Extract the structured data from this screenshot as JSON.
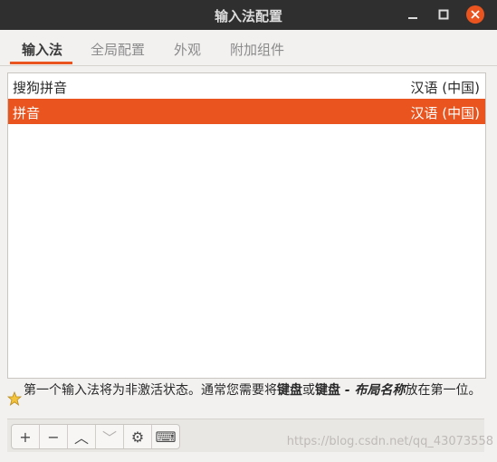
{
  "window": {
    "title": "输入法配置",
    "accent_color": "#e9541f"
  },
  "tabs": [
    {
      "label": "输入法",
      "active": true
    },
    {
      "label": "全局配置",
      "active": false
    },
    {
      "label": "外观",
      "active": false
    },
    {
      "label": "附加组件",
      "active": false
    }
  ],
  "input_methods": [
    {
      "name": "搜狗拼音",
      "language": "汉语 (中国)",
      "selected": false
    },
    {
      "name": "拼音",
      "language": "汉语 (中国)",
      "selected": true
    }
  ],
  "hint": {
    "icon": "star-icon",
    "part1": "第一个输入法将为非激活状态。通常您需要将",
    "bold1": "键盘",
    "part2": "或",
    "bold2": "键盘",
    "italic": " - 布局名称",
    "part3": "放在第一位。"
  },
  "toolbar": {
    "buttons": [
      {
        "icon": "plus-icon",
        "glyph": "+",
        "enabled": true
      },
      {
        "icon": "minus-icon",
        "glyph": "−",
        "enabled": true
      },
      {
        "icon": "move-up-icon",
        "glyph": "︿",
        "enabled": true
      },
      {
        "icon": "move-down-icon",
        "glyph": "﹀",
        "enabled": false
      },
      {
        "icon": "gear-icon",
        "glyph": "⚙",
        "enabled": true
      },
      {
        "icon": "keyboard-icon",
        "glyph": "⌨",
        "enabled": true
      }
    ]
  },
  "watermark": "https://blog.csdn.net/qq_43073558"
}
